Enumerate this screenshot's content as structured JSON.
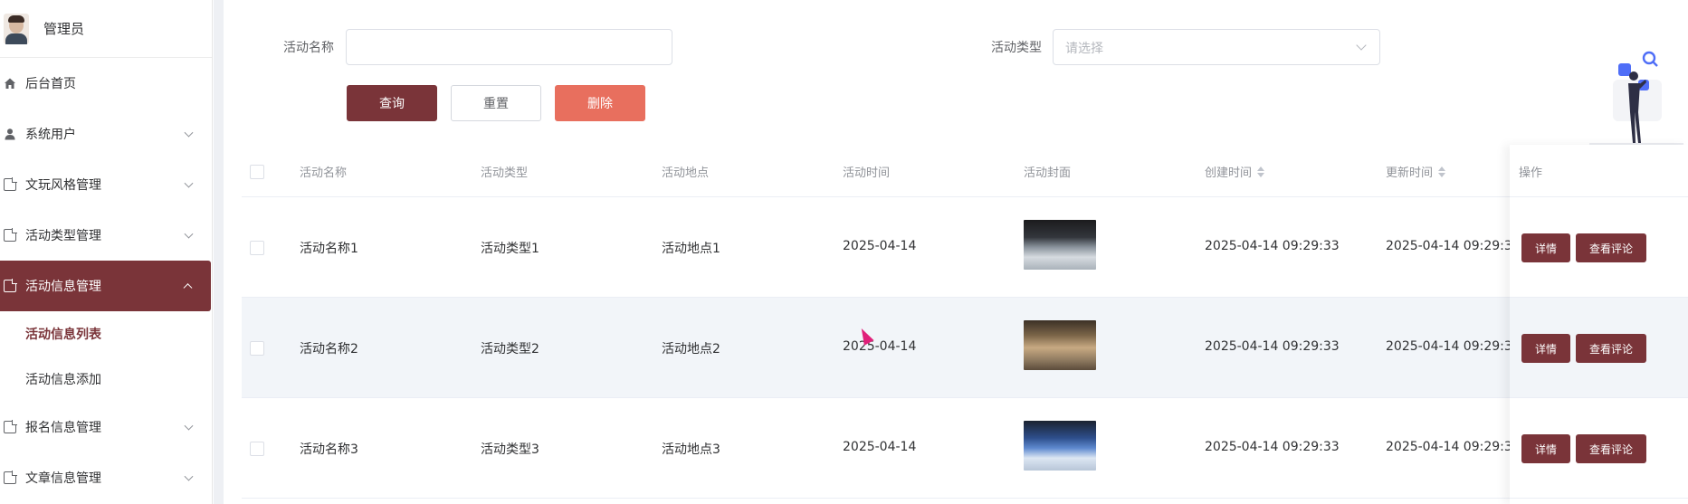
{
  "user": {
    "name": "管理员"
  },
  "sidebar": {
    "items": [
      {
        "label": "后台首页",
        "icon": "home-icon"
      },
      {
        "label": "系统用户",
        "icon": "user-icon"
      },
      {
        "label": "文玩风格管理",
        "icon": "document-icon"
      },
      {
        "label": "活动类型管理",
        "icon": "document-icon"
      },
      {
        "label": "活动信息管理",
        "icon": "document-icon"
      },
      {
        "label": "报名信息管理",
        "icon": "document-icon"
      },
      {
        "label": "文章信息管理",
        "icon": "document-icon"
      }
    ],
    "subitems": [
      {
        "label": "活动信息列表"
      },
      {
        "label": "活动信息添加"
      }
    ]
  },
  "search": {
    "name_label": "活动名称",
    "name_value": "",
    "type_label": "活动类型",
    "type_placeholder": "请选择",
    "query_label": "查询",
    "reset_label": "重置",
    "delete_label": "删除"
  },
  "table": {
    "headers": [
      "活动名称",
      "活动类型",
      "活动地点",
      "活动时间",
      "活动封面",
      "创建时间",
      "更新时间",
      "操作"
    ],
    "rows": [
      {
        "name": "活动名称1",
        "type": "活动类型1",
        "place": "活动地点1",
        "date": "2025-04-14",
        "created": "2025-04-14 09:29:33",
        "updated": "2025-04-14 09:29:3"
      },
      {
        "name": "活动名称2",
        "type": "活动类型2",
        "place": "活动地点2",
        "date": "2025-04-14",
        "created": "2025-04-14 09:29:33",
        "updated": "2025-04-14 09:29:3"
      },
      {
        "name": "活动名称3",
        "type": "活动类型3",
        "place": "活动地点3",
        "date": "2025-04-14",
        "created": "2025-04-14 09:29:33",
        "updated": "2025-04-14 09:29:3"
      }
    ],
    "detail_label": "详情",
    "comments_label": "查看评论"
  },
  "colors": {
    "primary": "#7a3439",
    "danger": "#e86f5e",
    "stripe": "#f2f5f9"
  }
}
